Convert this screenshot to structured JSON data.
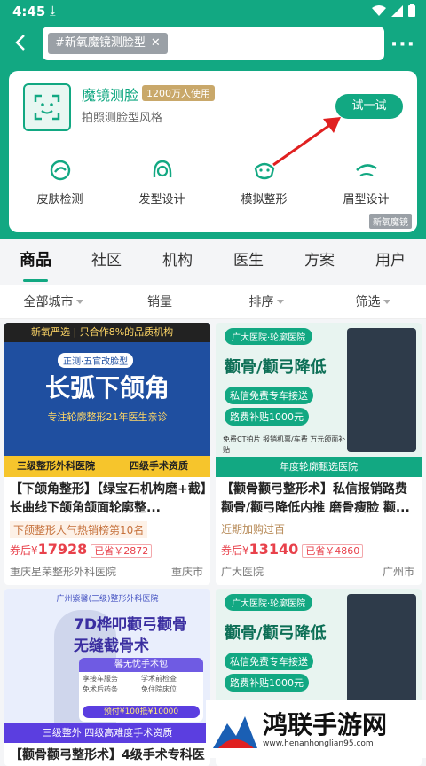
{
  "status": {
    "time": "4:45"
  },
  "search": {
    "chip": "#新氧魔镜测脸型"
  },
  "feature": {
    "title": "魔镜测脸",
    "badge": "1200万人使用",
    "subtitle": "拍照测脸型风格",
    "button": "试一试",
    "watermark": "新氧魔镜",
    "tools": [
      {
        "label": "皮肤检测",
        "icon": "skin-check-icon"
      },
      {
        "label": "发型设计",
        "icon": "hairstyle-icon"
      },
      {
        "label": "模拟整形",
        "icon": "simulate-surgery-icon"
      },
      {
        "label": "眉型设计",
        "icon": "eyebrow-icon"
      }
    ]
  },
  "tabs": [
    "商品",
    "社区",
    "机构",
    "医生",
    "方案",
    "用户"
  ],
  "filters": [
    "全部城市",
    "销量",
    "排序",
    "筛选"
  ],
  "products": [
    {
      "name": "【下颌角整形】【绿宝石机构磨+截】长曲线下颌角颌面轮廓整...",
      "tag": "下颌整形人气热销榜第10名",
      "currency": "券后¥",
      "price": "17928",
      "saved": "已省￥2872",
      "hospital": "重庆星荣整形外科医院",
      "city": "重庆市",
      "banner": {
        "header": "新氧严选 | 只合作8%的品质机构",
        "sub": "正测·五官改脸型",
        "headline": "长弧下颌角",
        "caption": "专注轮廓整形21年医生亲诊",
        "footer_left": "三级整形外科医院",
        "footer_right": "四级手术资质"
      }
    },
    {
      "name": "【颧骨颧弓整形术】私信报销路费 颧骨/颧弓降低内推 磨骨瘦脸 颧...",
      "tag": "近期加购过百",
      "currency": "券后¥",
      "price": "13140",
      "saved": "已省￥4860",
      "hospital": "广大医院",
      "city": "广州市",
      "banner": {
        "header": "广大医院·轮廓医院",
        "headline": "颧骨/颧弓降低",
        "line1": "私信免费专车接送",
        "line2": "路费补贴1000元",
        "features": "免费CT拍片  报销机票/车费  万元颌面补贴",
        "footer": "年度轮廓甄选医院"
      }
    },
    {
      "name": "【颧骨颧弓整形术】4级手术专科医",
      "banner": {
        "header": "广州紫馨(三级)整形外科医院",
        "headline": "7D桦叩颧弓颧骨",
        "headline2": "无缝截骨术",
        "package": "馨无忧手术包",
        "perks": [
          "享接车服务",
          "学术前检查",
          "免术后药条",
          "免住院床位"
        ],
        "promo": "预付¥100抵¥10000",
        "footer": "三级整外 四级高难度手术资质"
      }
    },
    {
      "banner": {
        "header": "广大医院·轮廓医院",
        "headline": "颧骨/颧弓降低",
        "line1": "私信免费专车接送",
        "line2": "路费补贴1000元"
      }
    }
  ],
  "watermark": {
    "title": "鸿联手游网",
    "url": "www.henanhonglian95.com"
  },
  "colors": {
    "brand": "#12a882",
    "price": "#e8414b"
  }
}
